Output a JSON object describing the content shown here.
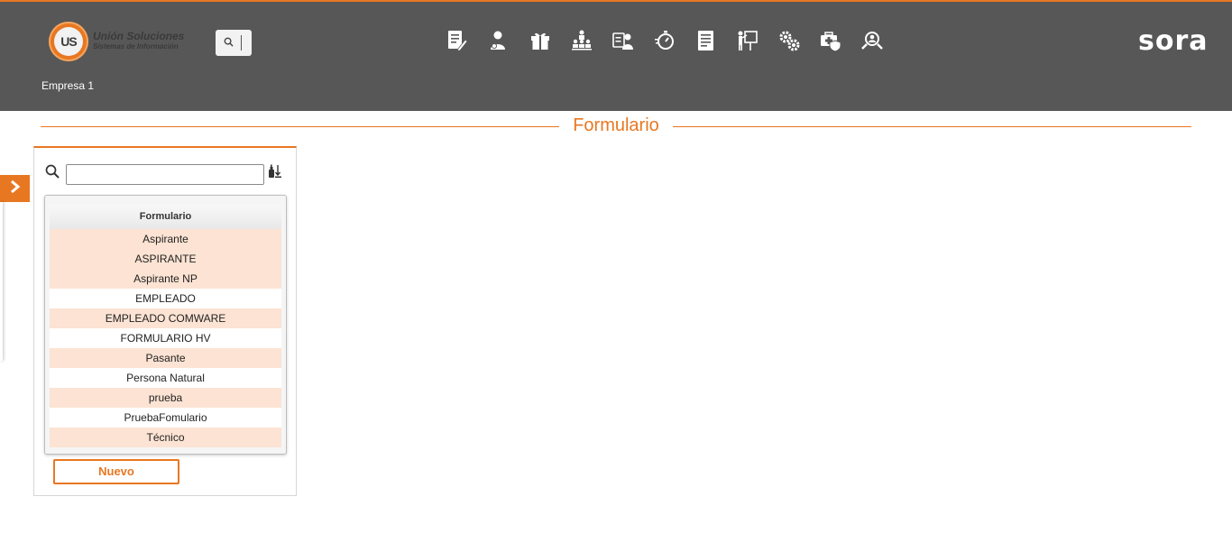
{
  "header": {
    "logo_title": "Unión Soluciones",
    "logo_subtitle": "Sistemas de Información",
    "logo_mark": "US",
    "brand": "sora",
    "company": "Empresa 1",
    "nav_icons": [
      "forms-icon",
      "user-admin-icon",
      "gift-icon",
      "org-chart-icon",
      "employee-card-icon",
      "timer-icon",
      "document-list-icon",
      "training-icon",
      "settings-gears-icon",
      "medical-case-icon",
      "search-people-icon"
    ]
  },
  "page": {
    "title": "Formulario"
  },
  "filter": {
    "value": "",
    "placeholder": ""
  },
  "grid": {
    "column_header": "Formulario",
    "rows": [
      "Aspirante",
      "ASPIRANTE",
      "Aspirante NP",
      "EMPLEADO",
      "EMPLEADO COMWARE",
      "FORMULARIO HV",
      "Pasante",
      "Persona Natural",
      "prueba",
      "PruebaFomulario",
      "Técnico"
    ],
    "row_shading": [
      "alt",
      "alt",
      "alt",
      "plain",
      "alt",
      "plain",
      "alt",
      "plain",
      "alt",
      "plain",
      "alt"
    ]
  },
  "actions": {
    "new_label": "Nuevo"
  },
  "colors": {
    "accent": "#e87722",
    "header_bg": "#575757",
    "row_highlight": "#fce3d3"
  }
}
